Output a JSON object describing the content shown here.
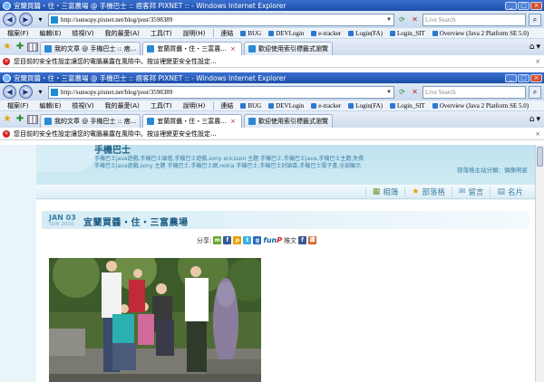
{
  "ie_windows": [
    {
      "title": "宜蘭買醬・住・三富農場 @ 手機巴士 :: 痞客邦 PIXNET :: - Windows Internet Explorer",
      "url": "http://sunsopy.pixnet.net/blog/post/3598389",
      "search_placeholder": "Live Search",
      "menu": [
        "檔案(F)",
        "編輯(E)",
        "檢視(V)",
        "我的最愛(A)",
        "工具(T)",
        "說明(H)"
      ],
      "links_label": "連結",
      "links": [
        "BUG",
        "DEVLogin",
        "e-tracker",
        "Login(FA)",
        "Login_SIT",
        "Overview (Java 2 Platform SE 5.0)"
      ],
      "tabs": [
        "我的文章 @ 手機巴士 :: 痞...",
        "宜蘭買醬・住・三富農...",
        "歡迎使用索引標籤式瀏覽"
      ],
      "infobar": "您目前的安全性設定讓您的電腦暴露在風險中。按這裡變更安全性設定..."
    },
    {
      "title": "宜蘭買醬・住・三富農場 @ 手機巴士 :: 痞客邦 PIXNET :: - Windows Internet Explorer",
      "url": "http://sunsopy.pixnet.net/blog/post/3598389",
      "search_placeholder": "Live Search",
      "menu": [
        "檔案(F)",
        "編輯(E)",
        "檢視(V)",
        "我的最愛(A)",
        "工具(T)",
        "說明(H)"
      ],
      "links_label": "連結",
      "links": [
        "BUG",
        "DEVLogin",
        "e-tracker",
        "Login(FA)",
        "Login_SIT",
        "Overview (Java 2 Platform SE 5.0)"
      ],
      "tabs": [
        "我的文章 @ 手機巴士 :: 痞...",
        "宜蘭買醬・住・三富農...",
        "歡迎使用索引標籤式瀏覽"
      ],
      "infobar": "您目前的安全性設定讓您的電腦暴露在風險中。按這裡變更安全性設定..."
    }
  ],
  "blog": {
    "title": "手機巴士",
    "description": "手機巴士java遊戲,手機巴士論壇,手機巴士遊戲,sony ericsson 主題 手機巴士,手機巴士java,手機巴士主題,免費手機巴士java遊戲,sony 主題 手機巴士,手機巴士網,nokia 手機巴士,手機巴士討論區,手機巴士電子書,全部顯示",
    "owner_text": "部落格主站分類：偶像明星",
    "actions": [
      {
        "icon": "▦",
        "label": "相簿",
        "name": "album"
      },
      {
        "icon": "★",
        "label": "部落格",
        "name": "blog"
      },
      {
        "icon": "✉",
        "label": "留言",
        "name": "guestbook"
      },
      {
        "icon": "▤",
        "label": "名片",
        "name": "card"
      }
    ],
    "post": {
      "date_month": "JAN 03",
      "date_day": "SUN 2010",
      "title": "宜蘭買醬・住・三富農場",
      "share_label": "分享:",
      "funp_label": "推文"
    }
  }
}
